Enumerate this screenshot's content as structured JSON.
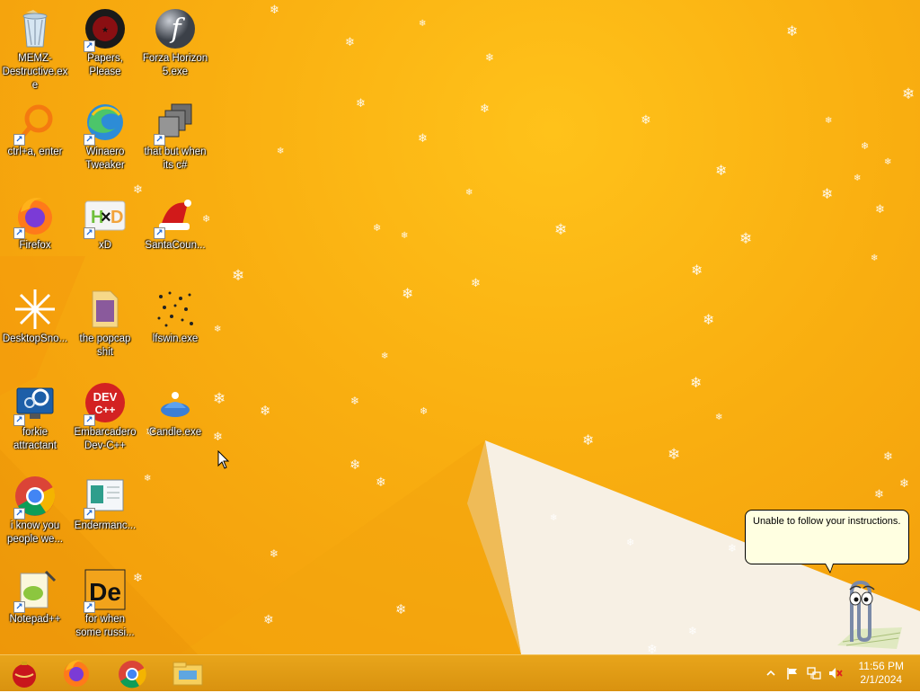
{
  "desktop": {
    "icons": [
      {
        "label": "MEMZ-Destructive.exe",
        "icon": "recycle-bin-icon"
      },
      {
        "label": "Papers, Please",
        "icon": "papers-please-icon"
      },
      {
        "label": "Forza Horizon 5.exe",
        "icon": "flash-player-icon"
      },
      {
        "label": "ctrl+a, enter",
        "icon": "magnifier-ring-icon"
      },
      {
        "label": "Winaero Tweaker",
        "icon": "edge-browser-icon"
      },
      {
        "label": "that but when its c#",
        "icon": "stacked-windows-icon"
      },
      {
        "label": "Firefox",
        "icon": "firefox-icon"
      },
      {
        "label": "xD",
        "icon": "hxd-hex-editor-icon"
      },
      {
        "label": "SantaCoun...",
        "icon": "santa-hat-icon"
      },
      {
        "label": "DesktopSno...",
        "icon": "snowflake-icon"
      },
      {
        "label": "the popcap shit",
        "icon": "folder-icon"
      },
      {
        "label": "lfswin.exe",
        "icon": "dots-icon"
      },
      {
        "label": "forkie attractant",
        "icon": "computer-gear-icon"
      },
      {
        "label": "Embarcadero Dev-C++",
        "icon": "dev-cpp-icon"
      },
      {
        "label": "Candle.exe",
        "icon": "candle-icon"
      },
      {
        "label": "i know you people we...",
        "icon": "chrome-icon"
      },
      {
        "label": "Endermanc...",
        "icon": "window-app-icon"
      },
      {
        "label": "Notepad++",
        "icon": "notepad-plus-plus-icon"
      },
      {
        "label": "for when some russi...",
        "icon": "de-app-icon"
      }
    ]
  },
  "clippy": {
    "message": "Unable to follow your instructions."
  },
  "taskbar": {
    "pinned": [
      {
        "name": "santa-count-ornament-icon"
      },
      {
        "name": "firefox-icon"
      },
      {
        "name": "chrome-icon"
      },
      {
        "name": "file-explorer-icon"
      }
    ],
    "tray": [
      "show-hidden-icons",
      "action-center-flag-icon",
      "network-icon",
      "volume-muted-icon"
    ],
    "time": "11:56 PM",
    "date": "2/1/2024"
  },
  "colors": {
    "wallpaper_accent": "#f9ae10",
    "taskbar": "#e0a015",
    "balloon_background": "#ffffe1"
  }
}
